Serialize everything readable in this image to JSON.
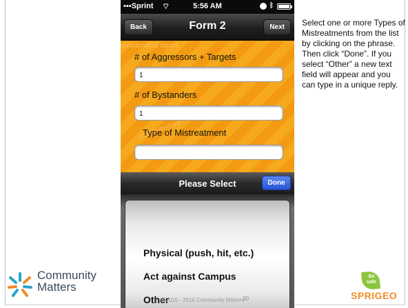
{
  "status": {
    "carrier": "Sprint",
    "time": "5:56 AM"
  },
  "nav": {
    "back": "Back",
    "title": "Form 2",
    "next": "Next"
  },
  "form": {
    "watermark": "unsubmitted report",
    "watermark2": "unsubmitted rep",
    "fields": [
      {
        "label": "# of Aggressors + Targets",
        "value": "1"
      },
      {
        "label": "# of Bystanders",
        "value": "1"
      },
      {
        "label": "Type of Mistreatment",
        "value": ""
      }
    ]
  },
  "picker": {
    "title": "Please Select",
    "done": "Done",
    "options": [
      "Physical (push, hit, etc.)",
      "Act against Campus",
      "Other"
    ],
    "copyright": "© 2010 - 2016 Community Matters",
    "page_number": "30"
  },
  "instructions": "Select one or more Types of Mistreatments from the list by clicking on the phrase. Then click “Done”. If you select “Other” a new text field will appear and you can type in a unique reply.",
  "logos": {
    "community_matters": [
      "Community",
      "Matters"
    ],
    "sprigeo_badge": [
      "Be",
      "safe"
    ],
    "sprigeo": "SPRIGEO"
  },
  "colors": {
    "orange": "#f5a623",
    "done_blue": "#2f5fe0",
    "cm_teal": "#2aa3c8",
    "cm_orange": "#f28c28"
  }
}
